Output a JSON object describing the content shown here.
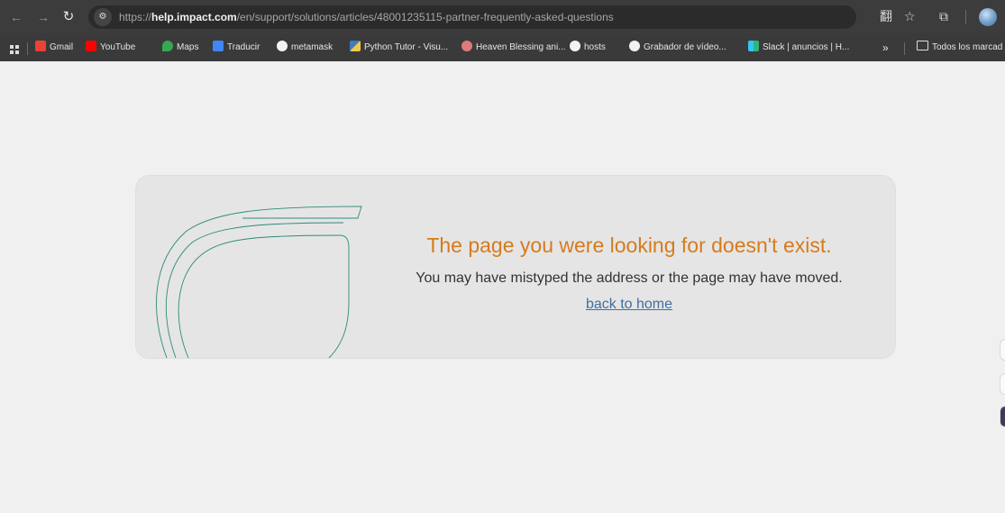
{
  "browser": {
    "url_scheme": "https://",
    "url_host": "help.impact.com",
    "url_path": "/en/support/solutions/articles/48001235115-partner-frequently-asked-questions",
    "icons": {
      "back": "←",
      "forward": "→",
      "reload": "↻",
      "site_info": "⚙",
      "translate": "翻",
      "star": "☆",
      "extensions": "⧉"
    }
  },
  "bookmarks": {
    "items": [
      {
        "label": "Gmail",
        "color": "#ea4335"
      },
      {
        "label": "YouTube",
        "color": "#ff0000"
      },
      {
        "label": "Maps",
        "color": "#34a853"
      },
      {
        "label": "Traducir",
        "color": "#4285f4"
      },
      {
        "label": "metamask",
        "color": "#ffffff"
      },
      {
        "label": "Python Tutor - Visu...",
        "color": "#f2c94c"
      },
      {
        "label": "Heaven Blessing ani...",
        "color": "#e07a7a"
      },
      {
        "label": "hosts",
        "color": "#ffffff"
      },
      {
        "label": "Grabador de vídeo...",
        "color": "#ffffff"
      },
      {
        "label": "Slack | anuncios | H...",
        "color": "#36c5f0"
      }
    ],
    "overflow": "»",
    "all_bookmarks": "Todos los marcad"
  },
  "error": {
    "title": "The page you were looking for doesn't exist.",
    "message": "You may have mistyped the address or the page may have moved.",
    "link": "back to home"
  },
  "colors": {
    "title": "#d67b1c",
    "link": "#3f6fa0",
    "deco_line": "#2f8a7a"
  }
}
